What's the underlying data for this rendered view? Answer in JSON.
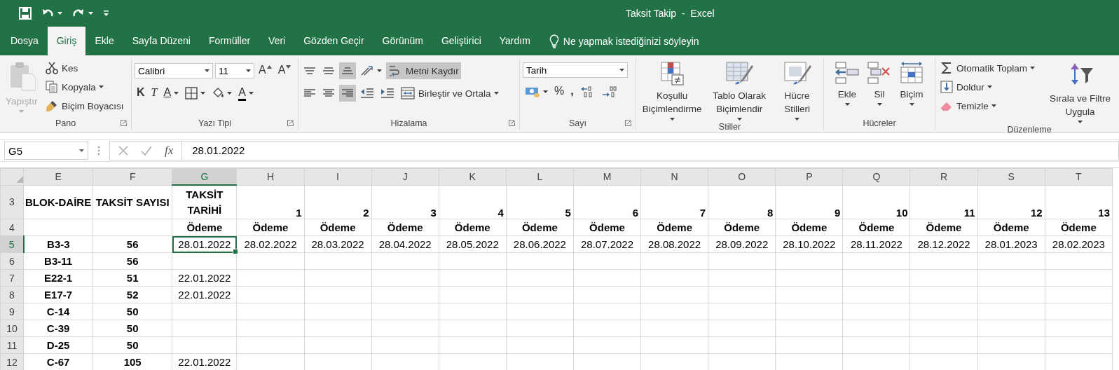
{
  "window": {
    "title": "Taksit Takip  -  Excel"
  },
  "menu_tabs": [
    {
      "label": "Dosya",
      "selected": false
    },
    {
      "label": "Giriş",
      "selected": true
    },
    {
      "label": "Ekle",
      "selected": false
    },
    {
      "label": "Sayfa Düzeni",
      "selected": false
    },
    {
      "label": "Formüller",
      "selected": false
    },
    {
      "label": "Veri",
      "selected": false
    },
    {
      "label": "Gözden Geçir",
      "selected": false
    },
    {
      "label": "Görünüm",
      "selected": false
    },
    {
      "label": "Geliştirici",
      "selected": false
    },
    {
      "label": "Yardım",
      "selected": false
    }
  ],
  "tell_me": "Ne yapmak istediğinizi söyleyin",
  "ribbon": [
    {
      "label": "Pano",
      "launcher": true,
      "columns": [
        {
          "kind": "large",
          "controls": [
            {
              "kind": "large",
              "label": "Yapıştır",
              "dropdown": true,
              "disabled": true
            }
          ]
        },
        {
          "kind": "stack",
          "controls": [
            {
              "kind": "labeled",
              "label": "Kes",
              "dropdown": false
            },
            {
              "kind": "labeled",
              "label": "Kopyala",
              "dropdown": true
            },
            {
              "kind": "labeled",
              "label": "Biçim Boyacısı",
              "dropdown": false
            }
          ]
        }
      ]
    },
    {
      "label": "Yazı Tipi",
      "launcher": true,
      "columns": [
        {
          "kind": "rows",
          "tiers": [
            {
              "controls": [
                {
                  "kind": "combo",
                  "value": "Calibri"
                },
                {
                  "kind": "combo",
                  "value": "11"
                },
                {
                  "kind": "glyph-icon",
                  "label": "A"
                },
                {
                  "kind": "glyph-icon",
                  "label": "A"
                }
              ]
            },
            {
              "controls": [
                {
                  "kind": "bold-glyph",
                  "label": "K"
                },
                {
                  "kind": "italic-glyph",
                  "label": "T"
                },
                {
                  "kind": "underline-glyph",
                  "label": "A",
                  "dropdown": true
                },
                {
                  "kind": "icon",
                  "dropdown": true
                },
                {
                  "kind": "icon",
                  "dropdown": true
                },
                {
                  "kind": "color-glyph",
                  "label": "A",
                  "dropdown": true,
                  "color": "#000000"
                }
              ]
            }
          ]
        }
      ]
    },
    {
      "label": "Hizalama",
      "launcher": true,
      "columns": [
        {
          "kind": "rows",
          "tiers": [
            {
              "controls": [
                {
                  "kind": "icon",
                  "pressed": false
                },
                {
                  "kind": "icon",
                  "pressed": false
                },
                {
                  "kind": "icon",
                  "pressed": true
                },
                {
                  "kind": "icon",
                  "dropdown": true,
                  "pressed": false
                },
                {
                  "kind": "labeled",
                  "label": "Metni Kaydır",
                  "pressed": true
                }
              ]
            },
            {
              "controls": [
                {
                  "kind": "icon",
                  "pressed": false
                },
                {
                  "kind": "icon",
                  "pressed": false
                },
                {
                  "kind": "icon",
                  "pressed": true
                },
                {
                  "kind": "icon",
                  "pressed": false
                },
                {
                  "kind": "icon",
                  "pressed": false
                },
                {
                  "kind": "labeled",
                  "label": "Birleştir ve Ortala",
                  "dropdown": true,
                  "pressed": false
                }
              ]
            }
          ]
        }
      ]
    },
    {
      "label": "Sayı",
      "launcher": true,
      "columns": [
        {
          "kind": "rows",
          "tiers": [
            {
              "controls": [
                {
                  "kind": "combo",
                  "value": "Tarih"
                }
              ]
            },
            {
              "controls": [
                {
                  "kind": "icon",
                  "dropdown": true
                },
                {
                  "kind": "glyph",
                  "label": "%"
                },
                {
                  "kind": "bold-glyph",
                  "label": ","
                },
                {
                  "kind": "icon"
                },
                {
                  "kind": "icon"
                }
              ]
            }
          ]
        }
      ]
    },
    {
      "label": "Stiller",
      "launcher": false,
      "columns": [
        {
          "kind": "large",
          "controls": [
            {
              "kind": "large",
              "label": "Koşullu Biçimlendirme",
              "dropdown": true
            },
            {
              "kind": "large",
              "label": "Tablo Olarak Biçimlendir",
              "dropdown": true
            },
            {
              "kind": "large",
              "label": "Hücre Stilleri",
              "dropdown": true
            }
          ]
        }
      ]
    },
    {
      "label": "Hücreler",
      "launcher": false,
      "columns": [
        {
          "kind": "large",
          "controls": [
            {
              "kind": "large",
              "label": "Ekle",
              "dropdown": true
            },
            {
              "kind": "large",
              "label": "Sil",
              "dropdown": true
            },
            {
              "kind": "large",
              "label": "Biçim",
              "dropdown": true
            }
          ]
        }
      ]
    },
    {
      "label": "Düzenleme",
      "launcher": false,
      "columns": [
        {
          "kind": "stack",
          "controls": [
            {
              "kind": "labeled",
              "label": "Otomatik Toplam",
              "dropdown": true
            },
            {
              "kind": "labeled",
              "label": "Doldur",
              "dropdown": true
            },
            {
              "kind": "labeled",
              "label": "Temizle",
              "dropdown": true
            }
          ]
        },
        {
          "kind": "large",
          "controls": [
            {
              "kind": "large",
              "label": "Sırala ve Filtre Uygula",
              "dropdown": true
            }
          ]
        }
      ]
    }
  ],
  "formula_bar": {
    "name_box": "G5",
    "fx": "fx",
    "value": "28.01.2022"
  },
  "sheet": {
    "columns": [
      {
        "label": "E",
        "selected": false
      },
      {
        "label": "F",
        "selected": false
      },
      {
        "label": "G",
        "selected": true
      },
      {
        "label": "H",
        "selected": false
      },
      {
        "label": "I",
        "selected": false
      },
      {
        "label": "J",
        "selected": false
      },
      {
        "label": "K",
        "selected": false
      },
      {
        "label": "L",
        "selected": false
      },
      {
        "label": "M",
        "selected": false
      },
      {
        "label": "N",
        "selected": false
      },
      {
        "label": "O",
        "selected": false
      },
      {
        "label": "P",
        "selected": false
      },
      {
        "label": "Q",
        "selected": false
      },
      {
        "label": "R",
        "selected": false
      },
      {
        "label": "S",
        "selected": false
      },
      {
        "label": "T",
        "selected": false
      }
    ],
    "rows": [
      {
        "number": "3",
        "kind": "header",
        "selected": false,
        "cells": [
          "BLOK-DAİRE",
          "TAKSİT SAYISI",
          "TAKSİT TARİHİ",
          "1",
          "2",
          "3",
          "4",
          "5",
          "6",
          "7",
          "8",
          "9",
          "10",
          "11",
          "12",
          "13"
        ]
      },
      {
        "number": "4",
        "kind": "label",
        "selected": false,
        "cells": [
          null,
          null,
          "Ödeme",
          "Ödeme",
          "Ödeme",
          "Ödeme",
          "Ödeme",
          "Ödeme",
          "Ödeme",
          "Ödeme",
          "Ödeme",
          "Ödeme",
          "Ödeme",
          "Ödeme",
          "Ödeme",
          "Ödeme"
        ]
      },
      {
        "number": "5",
        "kind": "data",
        "selected": true,
        "cells": [
          "B3-3",
          "56",
          "28.01.2022",
          "28.02.2022",
          "28.03.2022",
          "28.04.2022",
          "28.05.2022",
          "28.06.2022",
          "28.07.2022",
          "28.08.2022",
          "28.09.2022",
          "28.10.2022",
          "28.11.2022",
          "28.12.2022",
          "28.01.2023",
          "28.02.2023"
        ]
      },
      {
        "number": "6",
        "kind": "data",
        "selected": false,
        "cells": [
          "B3-11",
          "56",
          null
        ]
      },
      {
        "number": "7",
        "kind": "data",
        "selected": false,
        "cells": [
          "E22-1",
          "51",
          "22.01.2022"
        ]
      },
      {
        "number": "8",
        "kind": "data",
        "selected": false,
        "cells": [
          "E17-7",
          "52",
          "22.01.2022"
        ]
      },
      {
        "number": "9",
        "kind": "data",
        "selected": false,
        "cells": [
          "C-14",
          "50",
          null
        ]
      },
      {
        "number": "10",
        "kind": "data",
        "selected": false,
        "cells": [
          "C-39",
          "50",
          null
        ]
      },
      {
        "number": "11",
        "kind": "data",
        "selected": false,
        "cells": [
          "D-25",
          "50",
          null
        ]
      },
      {
        "number": "12",
        "kind": "data",
        "selected": false,
        "cells": [
          "C-67",
          "105",
          "22.01.2022"
        ]
      }
    ]
  }
}
